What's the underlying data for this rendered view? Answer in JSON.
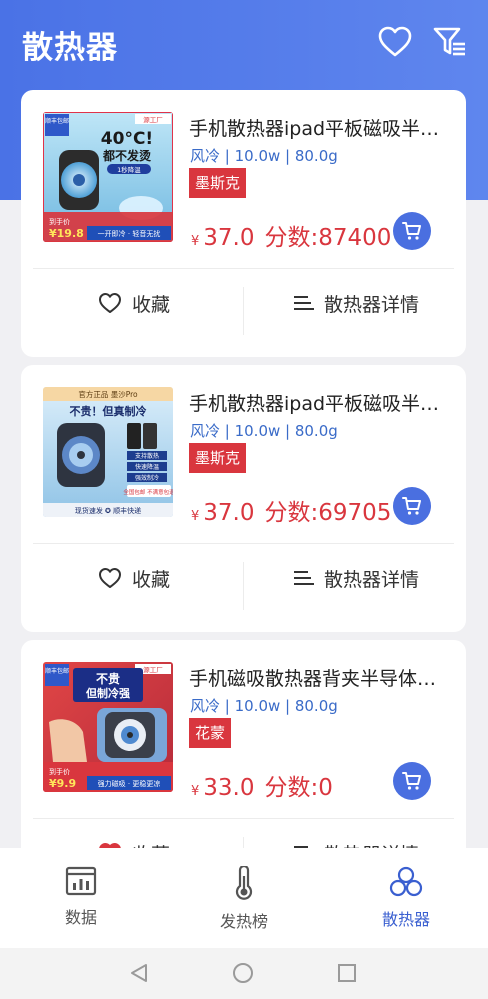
{
  "header": {
    "title": "散热器",
    "favorite_icon": "heart-outline-icon",
    "filter_icon": "filter-list-icon"
  },
  "colors": {
    "accent": "#4a72e6",
    "price": "#d9363e",
    "brand_tag": "#d9363e",
    "specs": "#3a6bc8",
    "active_tab": "#3a5fd0"
  },
  "products": [
    {
      "name": "手机散热器ipad平板磁吸半…",
      "specs": "风冷 | 10.0w | 80.0g",
      "brand": "墨斯克",
      "currency": "¥",
      "price": "37.0",
      "score": "分数:87400",
      "fav_label": "收藏",
      "detail_label": "散热器详情",
      "thumb": {
        "badge": "顺丰包邮",
        "corner": "源工厂",
        "headline": "40°C!",
        "subhead": "都不发烫",
        "note": "1秒降温",
        "footer": "一开即冷 · 轻音无扰",
        "price_tag": "¥19.8"
      }
    },
    {
      "name": "手机散热器ipad平板磁吸半…",
      "specs": "风冷 | 10.0w | 80.0g",
      "brand": "墨斯克",
      "currency": "¥",
      "price": "37.0",
      "score": "分数:69705",
      "fav_label": "收藏",
      "detail_label": "散热器详情",
      "thumb": {
        "top": "官方正品 墨沙Pro",
        "headline": "不贵！但真制冷",
        "f1": "支持散热",
        "f2": "快速降温",
        "f3": "强效制冷",
        "stamp": "全国包邮 不满意包退",
        "footer": "现货速发 ✪ 顺丰快递"
      }
    },
    {
      "name": "手机磁吸散热器背夹半导体…",
      "specs": "风冷 | 10.0w | 80.0g",
      "brand": "花蒙",
      "currency": "¥",
      "price": "33.0",
      "score": "分数:0",
      "fav_label": "收藏",
      "detail_label": "散热器详情",
      "thumb": {
        "badge": "顺丰包邮",
        "corner": "源工厂",
        "headline": "不贵",
        "subhead": "但制冷强",
        "footer": "强力磁吸 · 更稳更凉",
        "price_tag": "¥9.9"
      }
    }
  ],
  "tabs": [
    {
      "label": "数据",
      "icon": "bar-chart-icon",
      "active": false
    },
    {
      "label": "发热榜",
      "icon": "thermometer-icon",
      "active": false
    },
    {
      "label": "散热器",
      "icon": "fan-icon",
      "active": true
    }
  ],
  "system_nav": {
    "back_icon": "triangle-back-icon",
    "home_icon": "circle-home-icon",
    "recents_icon": "square-recents-icon"
  }
}
